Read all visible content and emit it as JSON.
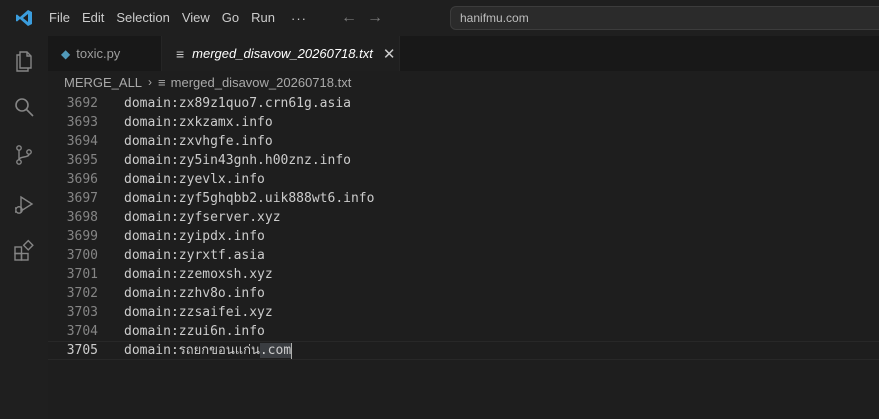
{
  "titlebar": {
    "menu": [
      "File",
      "Edit",
      "Selection",
      "View",
      "Go",
      "Run"
    ],
    "more": "···",
    "nav_back": "←",
    "nav_forward": "→",
    "search_text": "hanifmu.com"
  },
  "activity_bar": {
    "icons": [
      "explorer-icon",
      "search-icon",
      "source-control-icon",
      "run-debug-icon",
      "extensions-icon"
    ]
  },
  "tabs": [
    {
      "label": "toxic.py",
      "icon": "python-file-icon",
      "active": false
    },
    {
      "label": "merged_disavow_20260718.txt",
      "icon": "text-file-icon",
      "active": true,
      "close": "✕"
    }
  ],
  "breadcrumb": {
    "folder": "MERGE_ALL",
    "separator": "›",
    "file": "merged_disavow_20260718.txt"
  },
  "editor": {
    "lines": [
      {
        "num": "3692",
        "text": "domain:zx89z1quo7.crn61g.asia"
      },
      {
        "num": "3693",
        "text": "domain:zxkzamx.info"
      },
      {
        "num": "3694",
        "text": "domain:zxvhgfe.info"
      },
      {
        "num": "3695",
        "text": "domain:zy5in43gnh.h00znz.info"
      },
      {
        "num": "3696",
        "text": "domain:zyevlx.info"
      },
      {
        "num": "3697",
        "text": "domain:zyf5ghqbb2.uik888wt6.info"
      },
      {
        "num": "3698",
        "text": "domain:zyfserver.xyz"
      },
      {
        "num": "3699",
        "text": "domain:zyipdx.info"
      },
      {
        "num": "3700",
        "text": "domain:zyrxtf.asia"
      },
      {
        "num": "3701",
        "text": "domain:zzemoxsh.xyz"
      },
      {
        "num": "3702",
        "text": "domain:zzhv8o.info"
      },
      {
        "num": "3703",
        "text": "domain:zzsaifei.xyz"
      },
      {
        "num": "3704",
        "text": "domain:zzui6n.info"
      }
    ],
    "current_line": {
      "num": "3705",
      "prefix": "domain:รถยกขอนแก่น",
      "selected": ".com"
    }
  }
}
